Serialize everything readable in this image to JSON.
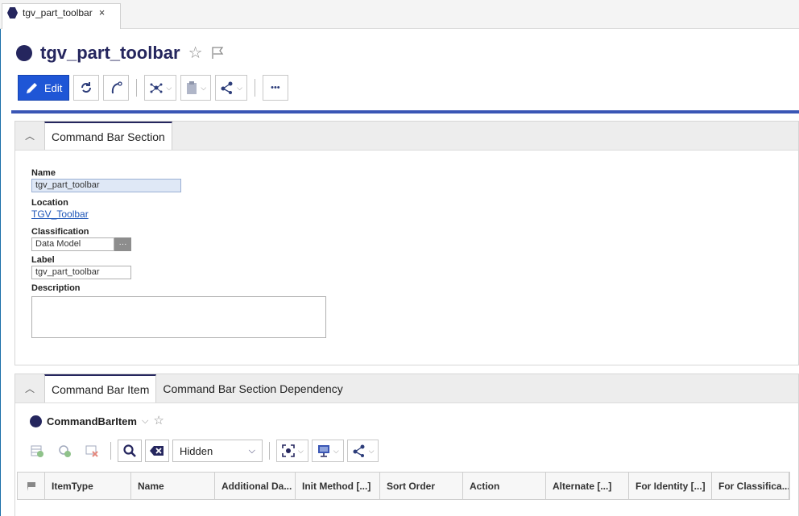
{
  "tab": {
    "label": "tgv_part_toolbar",
    "close": "×"
  },
  "title": "tgv_part_toolbar",
  "toolbar": {
    "edit_label": "Edit",
    "more": "•••"
  },
  "section1": {
    "tab_label": "Command Bar Section",
    "fields": {
      "name_label": "Name",
      "name_value": "tgv_part_toolbar",
      "location_label": "Location",
      "location_value": "TGV_Toolbar",
      "classification_label": "Classification",
      "classification_value": "Data Model",
      "classification_btn": "···",
      "label_label": "Label",
      "label_value": "tgv_part_toolbar",
      "description_label": "Description"
    }
  },
  "section2": {
    "tabs": [
      "Command Bar Item",
      "Command Bar Section Dependency"
    ],
    "grid_title": "CommandBarItem",
    "filter_select": "Hidden",
    "columns": [
      "ItemType",
      "Name",
      "Additional Da...",
      "Init Method [...]",
      "Sort Order",
      "Action",
      "Alternate [...]",
      "For Identity [...]",
      "For Classifica..."
    ]
  },
  "colors": {
    "accent": "#25265e",
    "edit_button": "#1f56d6",
    "link": "#1f56b8",
    "rule": "#3a56b5"
  }
}
